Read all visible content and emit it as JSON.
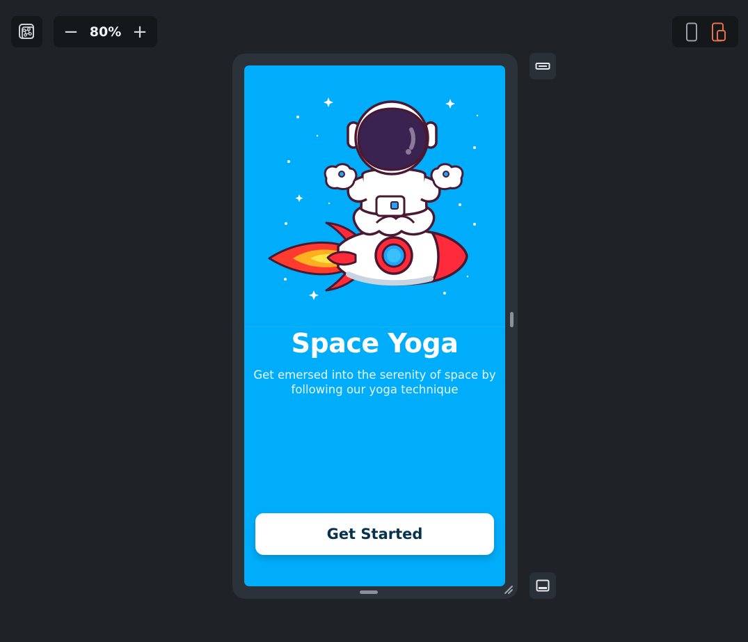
{
  "toolbar": {
    "fit_icon": "command-frame-icon",
    "zoom_out_label": "−",
    "zoom_value": "80%",
    "zoom_in_label": "+",
    "device_phone_icon": "phone-icon",
    "device_tablet_icon": "tablet-icon",
    "active_device_color": "#e8704f"
  },
  "side_buttons": {
    "top_icon": "status-bar-toggle-icon",
    "bottom_icon": "navigation-bar-toggle-icon"
  },
  "screen": {
    "background_color": "#00adfa",
    "illustration": "astronaut-meditating-on-rocket",
    "title": "Space Yoga",
    "subtitle": "Get emersed into the serenity of space by following our yoga technique",
    "cta_label": "Get Started"
  }
}
